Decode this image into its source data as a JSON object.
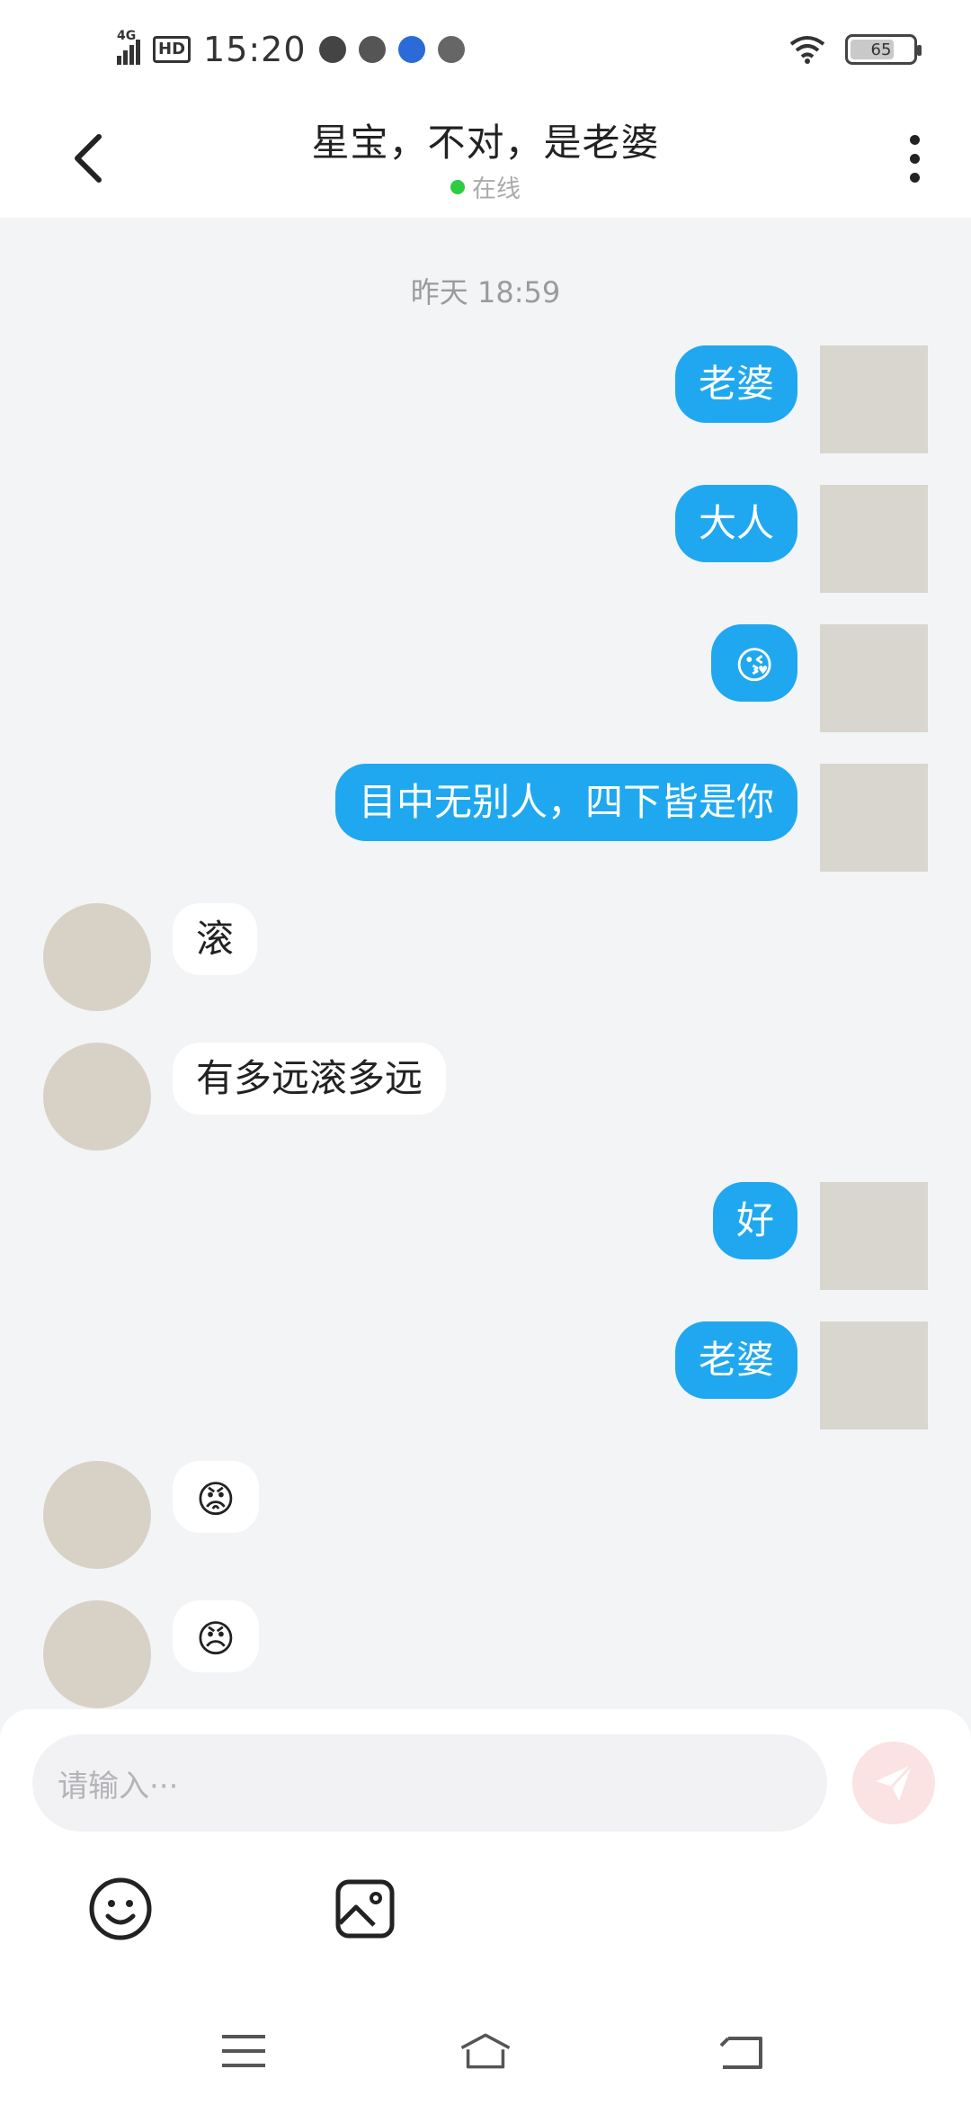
{
  "status_bar": {
    "network": "4G",
    "hd": "HD",
    "time": "15:20",
    "battery": "65",
    "battery_level": 0.65,
    "icons": [
      "wechat-icon",
      "soundwave-icon",
      "app-icon",
      "weibo-icon",
      "wifi-icon"
    ]
  },
  "header": {
    "title": "星宝，不对，是老婆",
    "status": "在线",
    "status_color": "#2ecc40"
  },
  "messages": {
    "timestamp": "昨天 18:59",
    "items": [
      {
        "side": "me",
        "text": "老婆"
      },
      {
        "side": "me",
        "text": "大人"
      },
      {
        "side": "me",
        "text": "😘"
      },
      {
        "side": "me",
        "text": "目中无别人，四下皆是你"
      },
      {
        "side": "her",
        "text": "滚"
      },
      {
        "side": "her",
        "text": "有多远滚多远"
      },
      {
        "side": "me",
        "text": "好"
      },
      {
        "side": "me",
        "text": "老婆"
      },
      {
        "side": "her",
        "text": "😡"
      },
      {
        "side": "her",
        "text": "😠"
      }
    ]
  },
  "input": {
    "placeholder": "请输入···"
  },
  "colors": {
    "bubble_me": "#1fa8f0",
    "bubble_her": "#ffffff",
    "background": "#f3f4f6"
  }
}
